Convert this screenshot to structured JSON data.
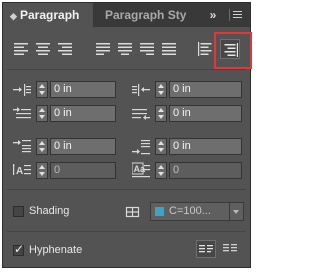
{
  "tabs": [
    {
      "label": "Paragraph",
      "active": true
    },
    {
      "label": "Paragraph Styles",
      "active": false
    }
  ],
  "controls": {
    "collapse_glyph": "»",
    "menu_icon": "panel-menu-icon"
  },
  "alignment": {
    "buttons": [
      "align-left",
      "align-center",
      "align-right",
      "justify-last-left",
      "justify-last-center",
      "justify-last-right",
      "justify-all",
      "align-towards-spine",
      "align-away-from-spine"
    ],
    "selected": "align-towards-spine"
  },
  "fields": {
    "left_indent": "0 in",
    "right_indent": "0 in",
    "first_line_indent": "0 in",
    "last_line_indent": "0 in",
    "space_before": "0 in",
    "space_after": "0 in",
    "drop_cap_lines": "0",
    "drop_cap_chars": "0"
  },
  "shading": {
    "label": "Shading",
    "checked": false,
    "color_value": "C=100...",
    "swatch_color": "#3aa3c9"
  },
  "hyphenate": {
    "label": "Hyphenate",
    "checked": true
  },
  "highlight_color": "#e53535"
}
